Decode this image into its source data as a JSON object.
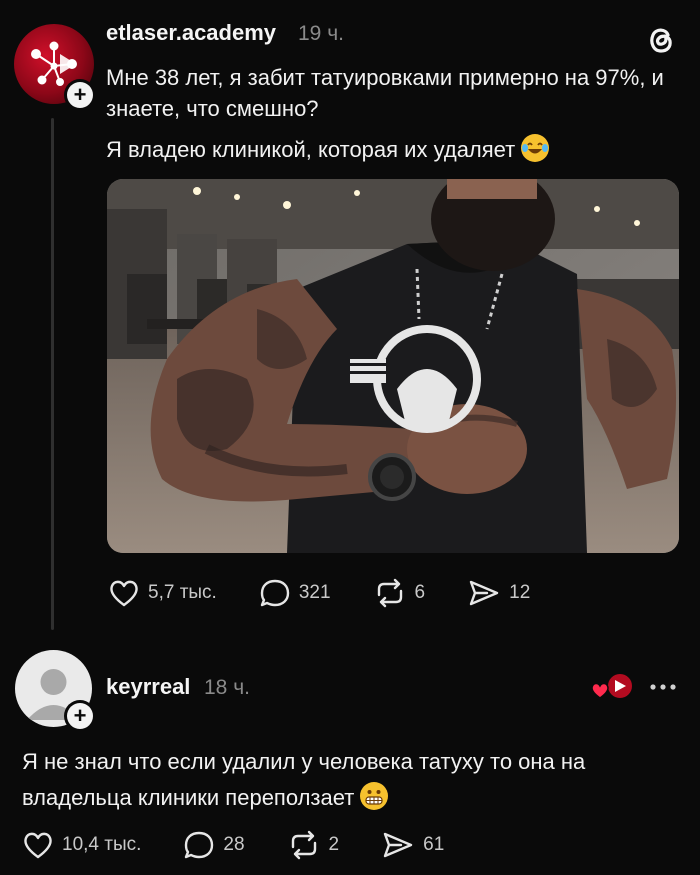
{
  "post": {
    "username": "etlaser.academy",
    "time": "19 ч.",
    "lines": [
      "Мне 38 лет, я забит татуировками примерно на 97%, и знаете, что смешно?",
      "Я владею клиникой, которая их удаляет"
    ],
    "emoji": "laughing-tears",
    "stats": {
      "likes": "5,7 тыс.",
      "comments": "321",
      "reposts": "6",
      "shares": "12"
    }
  },
  "reply": {
    "username": "keyrreal",
    "time": "18 ч.",
    "text": "Я не знал что если удалил у человека татуху то она на владельца клиники переползает",
    "emoji": "grimacing",
    "stats": {
      "likes": "10,4 тыс.",
      "comments": "28",
      "reposts": "2",
      "shares": "61"
    }
  },
  "colors": {
    "background": "#0a0a0a",
    "brand_red": "#c80d25",
    "secondary_text": "#8a8a8a",
    "like_heart_red": "#ff2a4d"
  }
}
